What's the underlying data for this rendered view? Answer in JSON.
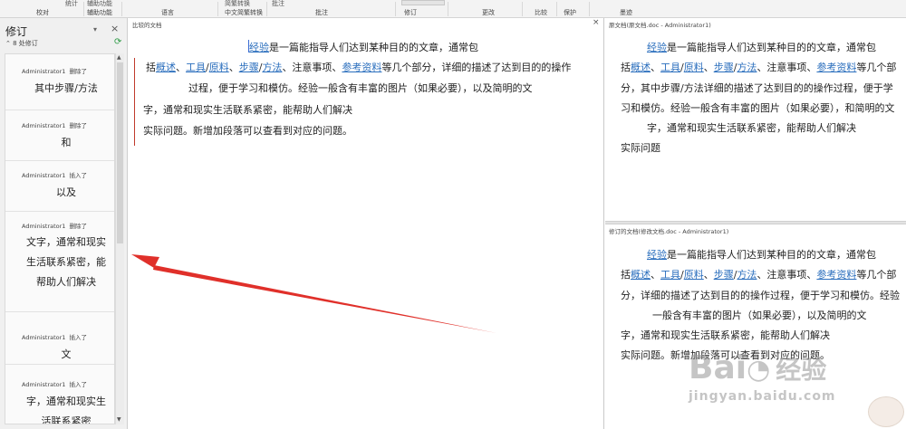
{
  "ribbon": {
    "tops": [
      "统计",
      "辅助功能",
      "简繁转换",
      "批注",
      "修订"
    ],
    "groups": [
      "校对",
      "辅助功能",
      "语言",
      "中文简繁转换",
      "批注",
      "修订",
      "更改",
      "比较",
      "保护",
      "墨迹"
    ]
  },
  "revision_pane": {
    "title": "修订",
    "count_text": "8 处修订",
    "items": [
      {
        "author": "Administrator1",
        "action": "删除了",
        "text": "其中步骤/方法"
      },
      {
        "author": "Administrator1",
        "action": "删除了",
        "text": "和"
      },
      {
        "author": "Administrator1",
        "action": "插入了",
        "text": "以及"
      },
      {
        "author": "Administrator1",
        "action": "删除了",
        "text": "文字，通常和现实生活联系紧密，能帮助人们解决"
      },
      {
        "author": "Administrator1",
        "action": "插入了",
        "text": "文"
      },
      {
        "author": "Administrator1",
        "action": "插入了",
        "text": "字，通常和现实生活联系紧密"
      }
    ]
  },
  "compared_doc": {
    "header": "比较的文档",
    "lines": [
      [
        "",
        "经验",
        "是一篇能指导人们达到某种目的的文章，通常包"
      ],
      [
        "括",
        "概述",
        "、",
        "工具",
        "/",
        "原料",
        "、",
        "步骤",
        "/",
        "方法",
        "、注意事项、",
        "参考资料",
        "等几个部分，详细的描述了达到目的的操作"
      ],
      [
        "",
        "",
        "过程，便于学习和模仿。经验一般含有丰富的图片（如果必要），以及简明的文"
      ],
      [
        "",
        "",
        "字，通常和现实生活联系紧密，能帮助人们解决"
      ],
      [
        "",
        "",
        "实际问题。新增加段落可以查看到对应的问题。"
      ]
    ]
  },
  "original_doc": {
    "header": "原文档(原文档.doc - Administrator1)",
    "lines": [
      [
        "",
        "经验",
        "是一篇能指导人们达到某种目的的文章，通常包"
      ],
      [
        "括",
        "概述",
        "、",
        "工具",
        "/",
        "原料",
        "、",
        "步骤",
        "/",
        "方法",
        "、注意事项、",
        "参考资料",
        "等几个部"
      ],
      [
        "",
        "",
        "分，其中步骤/方法详细的描述了达到目的的操作过程，便于学"
      ],
      [
        "",
        "",
        "习和模仿。经验一般含有丰富的图片（如果必要），和简明的文"
      ],
      [
        "",
        "",
        "字，通常和现实生活联系紧密，能帮助人们解决"
      ],
      [
        "",
        "",
        "实际问题"
      ]
    ]
  },
  "revised_doc": {
    "header": "修订的文档(修改文档.doc - Administrator1)",
    "lines": [
      [
        "",
        "经验",
        "是一篇能指导人们达到某种目的的文章，通常包"
      ],
      [
        "括",
        "概述",
        "、",
        "工具",
        "/",
        "原料",
        "、",
        "步骤",
        "/",
        "方法",
        "、注意事项、",
        "参考资料",
        "等几个部"
      ],
      [
        "",
        "",
        "分，详细的描述了达到目的的操作过程，便于学习和模仿。经验"
      ],
      [
        "",
        "",
        "一般含有丰富的图片（如果必要），以及简明的文"
      ],
      [
        "",
        "",
        "字，通常和现实生活联系紧密，能帮助人们解决"
      ],
      [
        "",
        "",
        "实际问题。新增加段落可以查看到对应的问题。"
      ]
    ]
  },
  "watermark": {
    "brand": "Bai",
    "brand2": "经验",
    "url": "jingyan.baidu.com"
  },
  "colors": {
    "link": "#2a6ebd",
    "change_bar": "#c0392b",
    "arrow": "#e0302a"
  }
}
